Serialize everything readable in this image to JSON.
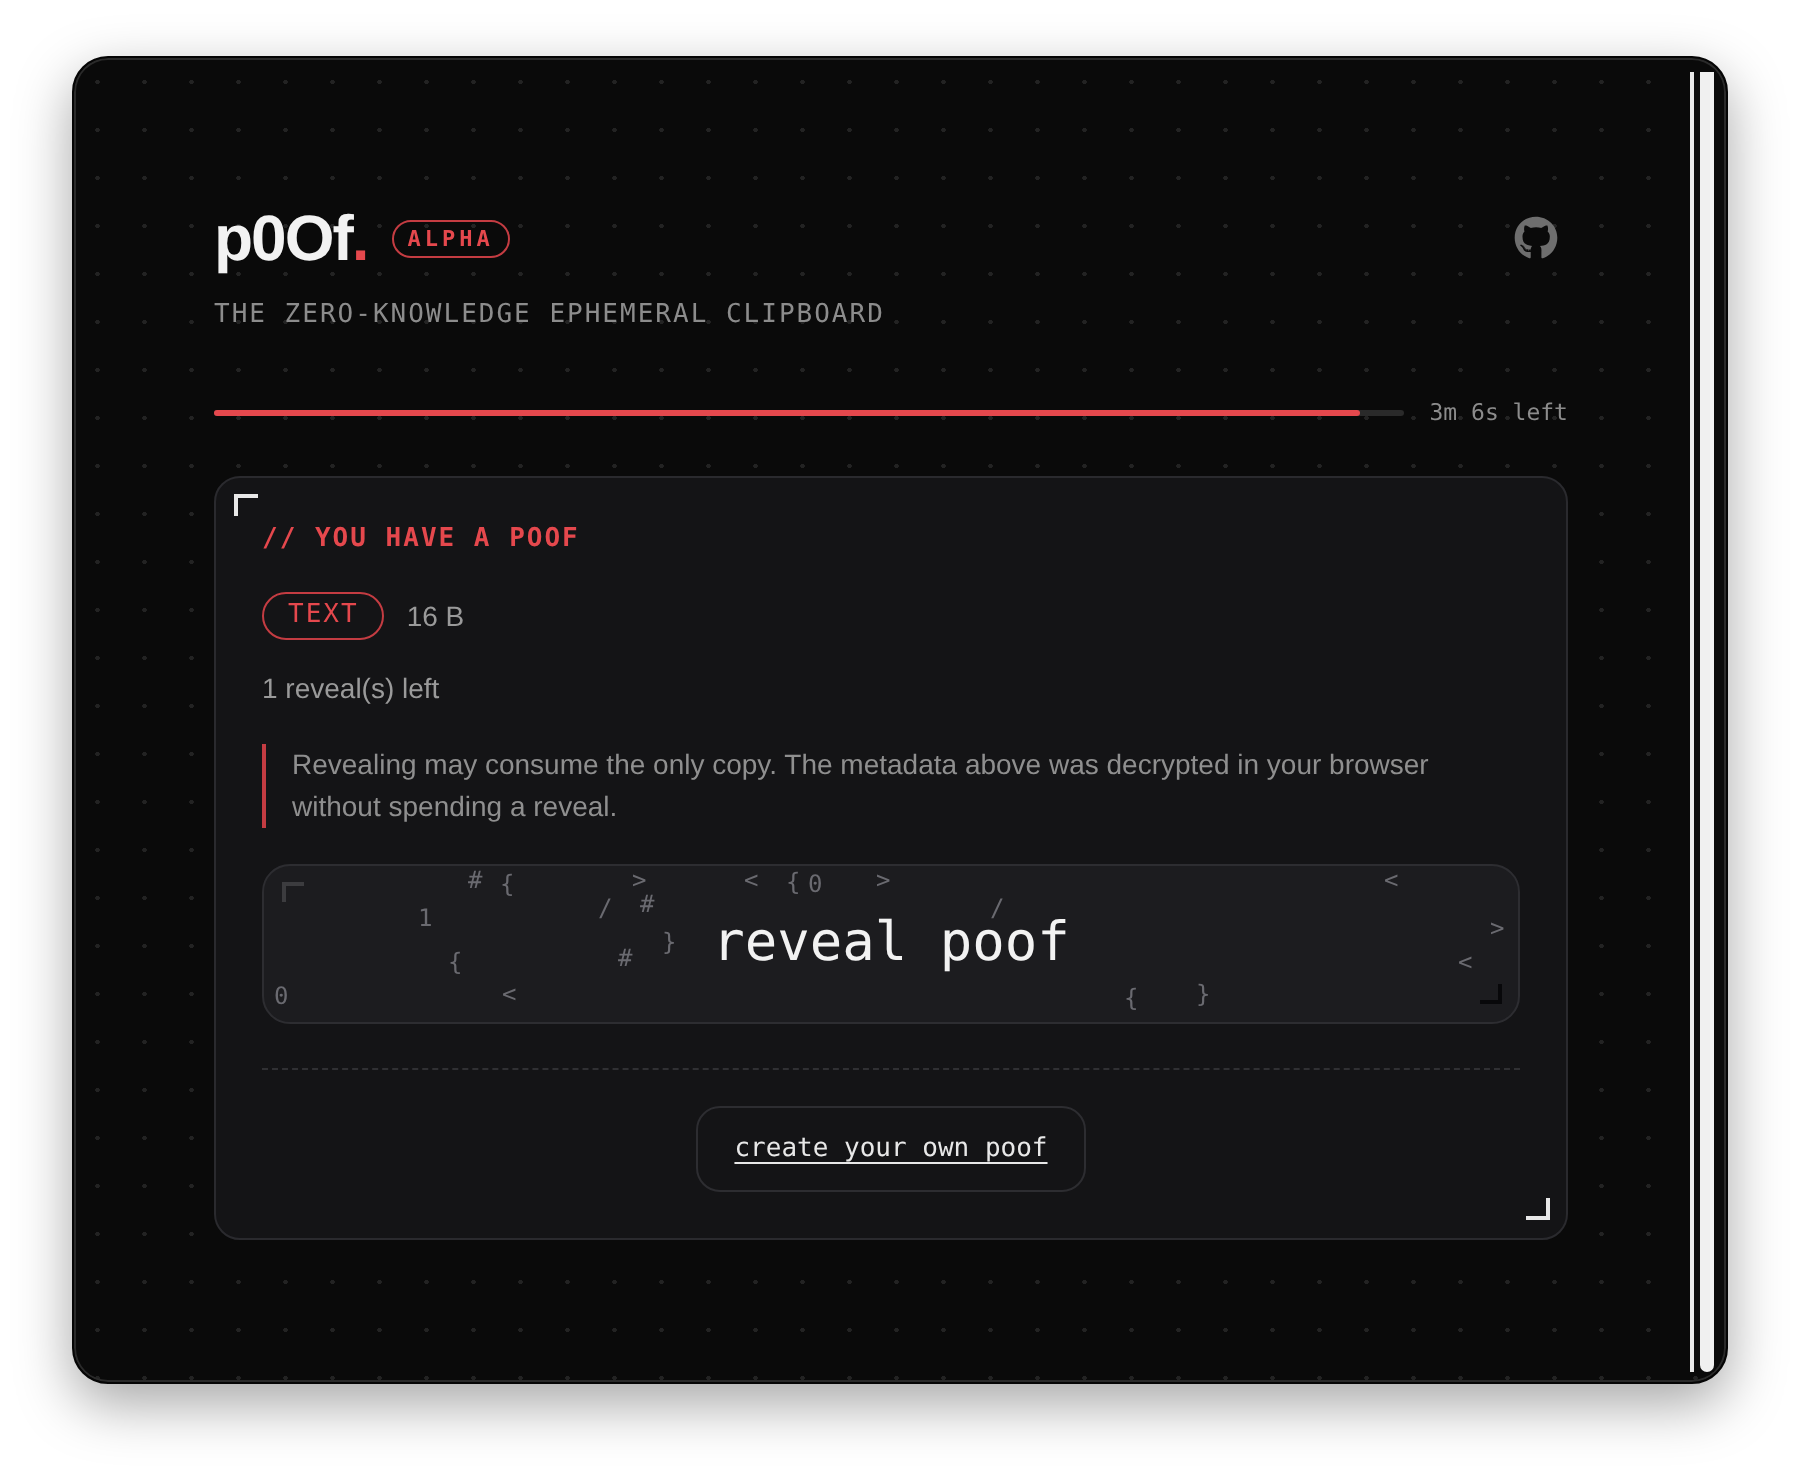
{
  "header": {
    "wordmark": "p0Of",
    "wordmark_dot": ".",
    "badge": "ALPHA",
    "tagline": "THE ZERO-KNOWLEDGE EPHEMERAL CLIPBOARD"
  },
  "expiry": {
    "level": 0.963,
    "reading": "3m 6s left"
  },
  "card": {
    "heading": "// YOU HAVE A POOF",
    "type_tag": "TEXT",
    "size": "16 B",
    "reveals_left": "1 reveal(s) left",
    "notice": "Revealing may consume the only copy. The metadata above was decrypted in your browser without spending a reveal.",
    "reveal_button": {
      "label": "reveal poof",
      "symbols": [
        "#",
        "{",
        ">",
        "<",
        "{",
        "0",
        ">",
        "<",
        "1",
        "/",
        "#",
        "/",
        ">",
        "}",
        "{",
        "#",
        "<",
        "0",
        "<",
        "{",
        "}"
      ]
    },
    "create_button": "create your own poof"
  }
}
